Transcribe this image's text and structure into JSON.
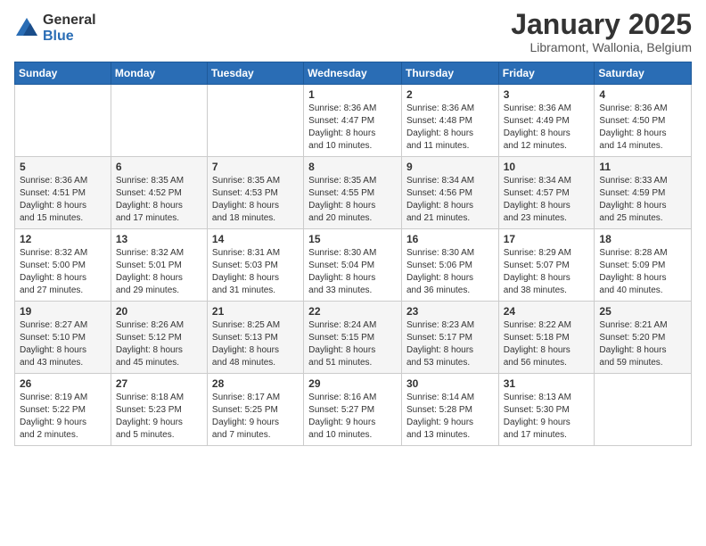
{
  "logo": {
    "general": "General",
    "blue": "Blue"
  },
  "header": {
    "month": "January 2025",
    "location": "Libramont, Wallonia, Belgium"
  },
  "days_of_week": [
    "Sunday",
    "Monday",
    "Tuesday",
    "Wednesday",
    "Thursday",
    "Friday",
    "Saturday"
  ],
  "weeks": [
    [
      {
        "day": "",
        "info": ""
      },
      {
        "day": "",
        "info": ""
      },
      {
        "day": "",
        "info": ""
      },
      {
        "day": "1",
        "info": "Sunrise: 8:36 AM\nSunset: 4:47 PM\nDaylight: 8 hours\nand 10 minutes."
      },
      {
        "day": "2",
        "info": "Sunrise: 8:36 AM\nSunset: 4:48 PM\nDaylight: 8 hours\nand 11 minutes."
      },
      {
        "day": "3",
        "info": "Sunrise: 8:36 AM\nSunset: 4:49 PM\nDaylight: 8 hours\nand 12 minutes."
      },
      {
        "day": "4",
        "info": "Sunrise: 8:36 AM\nSunset: 4:50 PM\nDaylight: 8 hours\nand 14 minutes."
      }
    ],
    [
      {
        "day": "5",
        "info": "Sunrise: 8:36 AM\nSunset: 4:51 PM\nDaylight: 8 hours\nand 15 minutes."
      },
      {
        "day": "6",
        "info": "Sunrise: 8:35 AM\nSunset: 4:52 PM\nDaylight: 8 hours\nand 17 minutes."
      },
      {
        "day": "7",
        "info": "Sunrise: 8:35 AM\nSunset: 4:53 PM\nDaylight: 8 hours\nand 18 minutes."
      },
      {
        "day": "8",
        "info": "Sunrise: 8:35 AM\nSunset: 4:55 PM\nDaylight: 8 hours\nand 20 minutes."
      },
      {
        "day": "9",
        "info": "Sunrise: 8:34 AM\nSunset: 4:56 PM\nDaylight: 8 hours\nand 21 minutes."
      },
      {
        "day": "10",
        "info": "Sunrise: 8:34 AM\nSunset: 4:57 PM\nDaylight: 8 hours\nand 23 minutes."
      },
      {
        "day": "11",
        "info": "Sunrise: 8:33 AM\nSunset: 4:59 PM\nDaylight: 8 hours\nand 25 minutes."
      }
    ],
    [
      {
        "day": "12",
        "info": "Sunrise: 8:32 AM\nSunset: 5:00 PM\nDaylight: 8 hours\nand 27 minutes."
      },
      {
        "day": "13",
        "info": "Sunrise: 8:32 AM\nSunset: 5:01 PM\nDaylight: 8 hours\nand 29 minutes."
      },
      {
        "day": "14",
        "info": "Sunrise: 8:31 AM\nSunset: 5:03 PM\nDaylight: 8 hours\nand 31 minutes."
      },
      {
        "day": "15",
        "info": "Sunrise: 8:30 AM\nSunset: 5:04 PM\nDaylight: 8 hours\nand 33 minutes."
      },
      {
        "day": "16",
        "info": "Sunrise: 8:30 AM\nSunset: 5:06 PM\nDaylight: 8 hours\nand 36 minutes."
      },
      {
        "day": "17",
        "info": "Sunrise: 8:29 AM\nSunset: 5:07 PM\nDaylight: 8 hours\nand 38 minutes."
      },
      {
        "day": "18",
        "info": "Sunrise: 8:28 AM\nSunset: 5:09 PM\nDaylight: 8 hours\nand 40 minutes."
      }
    ],
    [
      {
        "day": "19",
        "info": "Sunrise: 8:27 AM\nSunset: 5:10 PM\nDaylight: 8 hours\nand 43 minutes."
      },
      {
        "day": "20",
        "info": "Sunrise: 8:26 AM\nSunset: 5:12 PM\nDaylight: 8 hours\nand 45 minutes."
      },
      {
        "day": "21",
        "info": "Sunrise: 8:25 AM\nSunset: 5:13 PM\nDaylight: 8 hours\nand 48 minutes."
      },
      {
        "day": "22",
        "info": "Sunrise: 8:24 AM\nSunset: 5:15 PM\nDaylight: 8 hours\nand 51 minutes."
      },
      {
        "day": "23",
        "info": "Sunrise: 8:23 AM\nSunset: 5:17 PM\nDaylight: 8 hours\nand 53 minutes."
      },
      {
        "day": "24",
        "info": "Sunrise: 8:22 AM\nSunset: 5:18 PM\nDaylight: 8 hours\nand 56 minutes."
      },
      {
        "day": "25",
        "info": "Sunrise: 8:21 AM\nSunset: 5:20 PM\nDaylight: 8 hours\nand 59 minutes."
      }
    ],
    [
      {
        "day": "26",
        "info": "Sunrise: 8:19 AM\nSunset: 5:22 PM\nDaylight: 9 hours\nand 2 minutes."
      },
      {
        "day": "27",
        "info": "Sunrise: 8:18 AM\nSunset: 5:23 PM\nDaylight: 9 hours\nand 5 minutes."
      },
      {
        "day": "28",
        "info": "Sunrise: 8:17 AM\nSunset: 5:25 PM\nDaylight: 9 hours\nand 7 minutes."
      },
      {
        "day": "29",
        "info": "Sunrise: 8:16 AM\nSunset: 5:27 PM\nDaylight: 9 hours\nand 10 minutes."
      },
      {
        "day": "30",
        "info": "Sunrise: 8:14 AM\nSunset: 5:28 PM\nDaylight: 9 hours\nand 13 minutes."
      },
      {
        "day": "31",
        "info": "Sunrise: 8:13 AM\nSunset: 5:30 PM\nDaylight: 9 hours\nand 17 minutes."
      },
      {
        "day": "",
        "info": ""
      }
    ]
  ]
}
